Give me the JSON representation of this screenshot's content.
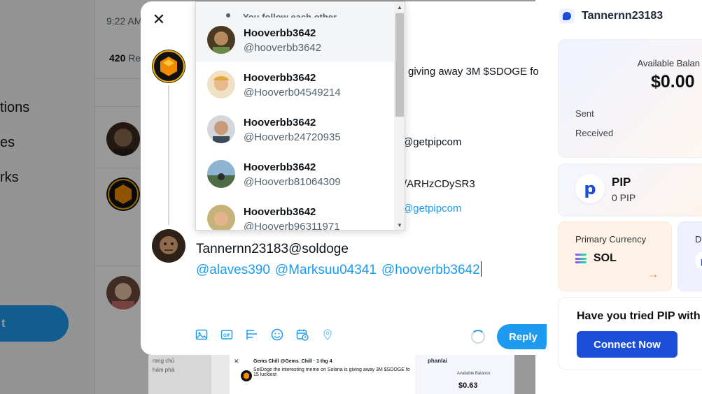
{
  "background": {
    "time": "9:22 AM",
    "stats": {
      "count": "420",
      "label": "Re"
    },
    "nav_items": [
      "tions",
      "es",
      "rks"
    ],
    "tweet_button": "t"
  },
  "modal": {
    "close_icon": "close-icon",
    "thread_tweet": {
      "line1": "giving away 3M $SDOGE fo",
      "line2": "@getpipcom",
      "line3": "/ARHzCDySR3",
      "line4": "@getpipcom"
    },
    "compose": {
      "user_line": "Tannernn23183@soldoge",
      "mentions": [
        "@alaves390",
        "@Marksuu04341",
        "@hooverbb3642"
      ]
    },
    "toolbar_icons": [
      "image-icon",
      "gif-icon",
      "poll-icon",
      "emoji-icon",
      "schedule-icon",
      "location-icon"
    ],
    "reply_label": "Reply"
  },
  "mention_dropdown": {
    "follow_note": "You follow each other",
    "items": [
      {
        "name": "Hooverbb3642",
        "handle": "@hooverbb3642"
      },
      {
        "name": "Hooverbb3642",
        "handle": "@Hooverb04549214"
      },
      {
        "name": "Hooverbb3642",
        "handle": "@Hooverb24720935"
      },
      {
        "name": "Hooverbb3642",
        "handle": "@Hooverb81064309"
      },
      {
        "name": "Hooverbb3642",
        "handle": "@Hooverb96311971"
      }
    ]
  },
  "wallet": {
    "username": "Tannernn23183",
    "available_balance_label": "Available Balan",
    "balance": "$0.00",
    "sent_label": "Sent",
    "received_label": "Received",
    "pip_name": "PIP",
    "pip_amount": "0 PIP",
    "primary_currency_label": "Primary Currency",
    "currency": "SOL",
    "second_card_label": "D",
    "try_title": "Have you tried PIP with",
    "connect_label": "Connect Now",
    "accent": "#1d4ed8"
  },
  "preview": {
    "side_items": [
      "rang chủ",
      "hám phá"
    ],
    "name": "Gems Chill @Gems_Chill · 1 thg 4",
    "text": "SolDoge the interesting meme on Solana is giving away 3M $SDOGE fo 15 luckiest",
    "app_name": "phanlai",
    "balance_label": "Available Balance",
    "balance": "$0.63"
  },
  "colors": {
    "twitter_blue": "#1d9bf0",
    "pip_blue": "#1d4ed8"
  }
}
